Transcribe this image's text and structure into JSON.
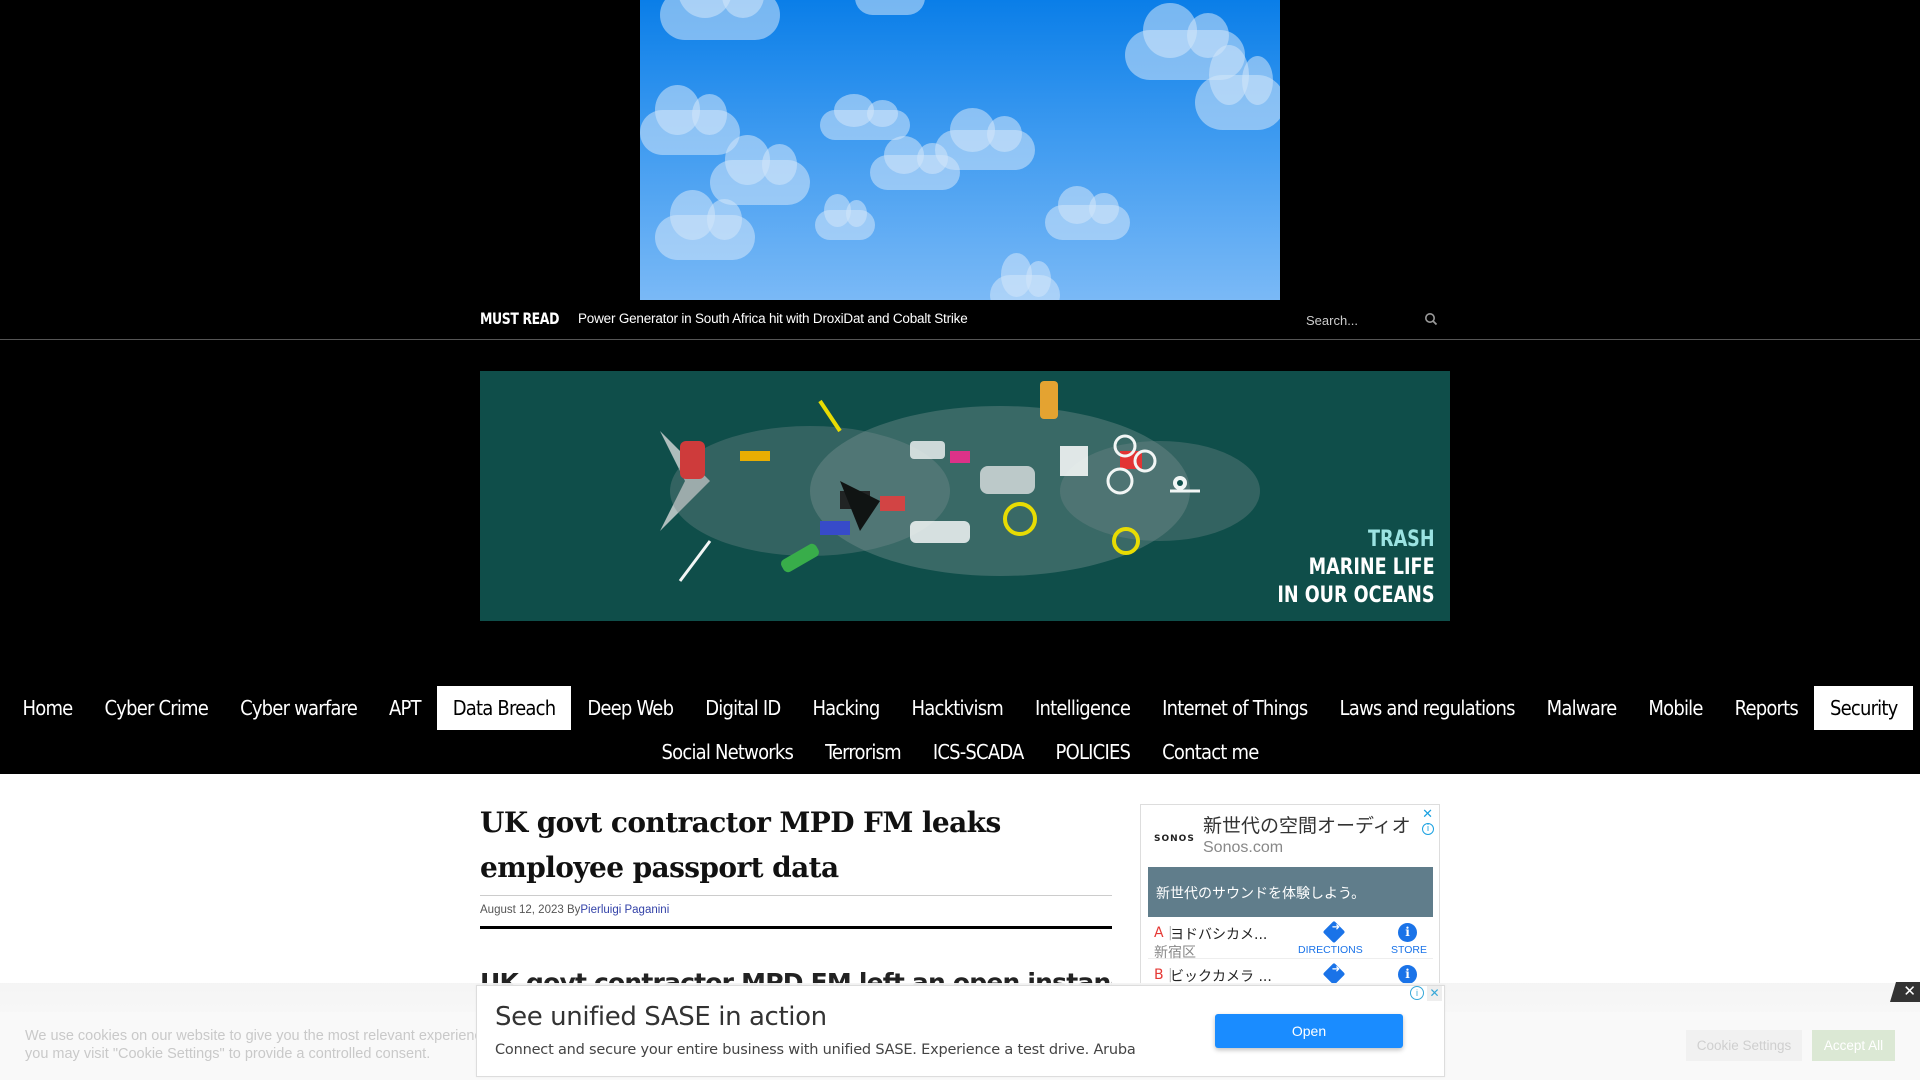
{
  "top_ad": {
    "description": "animated cloud background advertisement"
  },
  "must_read": {
    "label": "MUST READ",
    "headline": "Power Generator in South Africa hit with DroxiDat and Cobalt Strike",
    "search_placeholder": "Search...",
    "search_icon": "search-icon"
  },
  "banner": {
    "line1": "TRASH",
    "line2": "MARINE LIFE",
    "line3": "IN OUR OCEANS",
    "bg_color": "#0f4e4a",
    "accent_color": "#9be3e2"
  },
  "nav": {
    "row1": [
      {
        "label": "Home",
        "active": false
      },
      {
        "label": "Cyber Crime",
        "active": false
      },
      {
        "label": "Cyber warfare",
        "active": false
      },
      {
        "label": "APT",
        "active": false
      },
      {
        "label": "Data Breach",
        "active": true
      },
      {
        "label": "Deep Web",
        "active": false
      },
      {
        "label": "Digital ID",
        "active": false
      },
      {
        "label": "Hacking",
        "active": false
      },
      {
        "label": "Hacktivism",
        "active": false
      },
      {
        "label": "Intelligence",
        "active": false
      },
      {
        "label": "Internet of Things",
        "active": false
      },
      {
        "label": "Laws and regulations",
        "active": false
      },
      {
        "label": "Malware",
        "active": false
      },
      {
        "label": "Mobile",
        "active": false
      },
      {
        "label": "Reports",
        "active": false
      },
      {
        "label": "Security",
        "active": true
      }
    ],
    "row2": [
      {
        "label": "Social Networks",
        "active": false
      },
      {
        "label": "Terrorism",
        "active": false
      },
      {
        "label": "ICS-SCADA",
        "active": false
      },
      {
        "label": "POLICIES",
        "active": false
      },
      {
        "label": "Contact me",
        "active": false
      }
    ]
  },
  "article": {
    "title": "UK govt contractor MPD FM leaks employee passport data",
    "date": "August 12, 2023",
    "by": "By",
    "author": "Pierluigi Paganini",
    "lead": "UK govt contractor MPD FM left an open instance that exposed"
  },
  "sidebar_ad": {
    "brand": "SONOS",
    "headline": "新世代の空間オーディオ",
    "domain": "Sonos.com",
    "panel_text": "新世代のサウンドを体験しよう。",
    "stores": [
      {
        "letter": "A",
        "name": "ヨドバシカメ...",
        "location": "新宿区",
        "directions_label": "DIRECTIONS",
        "store_label": "STORE"
      },
      {
        "letter": "B",
        "name": "ビックカメラ ...",
        "location": "",
        "directions_label": "",
        "store_label": ""
      }
    ],
    "close_label": "✕",
    "info_label": "i"
  },
  "cookie_bar": {
    "text_line1": "We use cookies on our website to give you the most relevant experience by remembering your preferences and repeat visits. By clicking \"Accept All\",",
    "text_line2": "you may visit \"Cookie Settings\" to provide a controlled consent.",
    "settings_label": "Cookie Settings",
    "accept_label": "Accept All",
    "close_label": "✕"
  },
  "bottom_ad": {
    "headline": "See unified SASE in action",
    "description": "Connect and secure your entire business with unified SASE. Experience a test drive. Aruba",
    "button_label": "Open",
    "adchoices_label": "i",
    "close_label": "✕"
  }
}
